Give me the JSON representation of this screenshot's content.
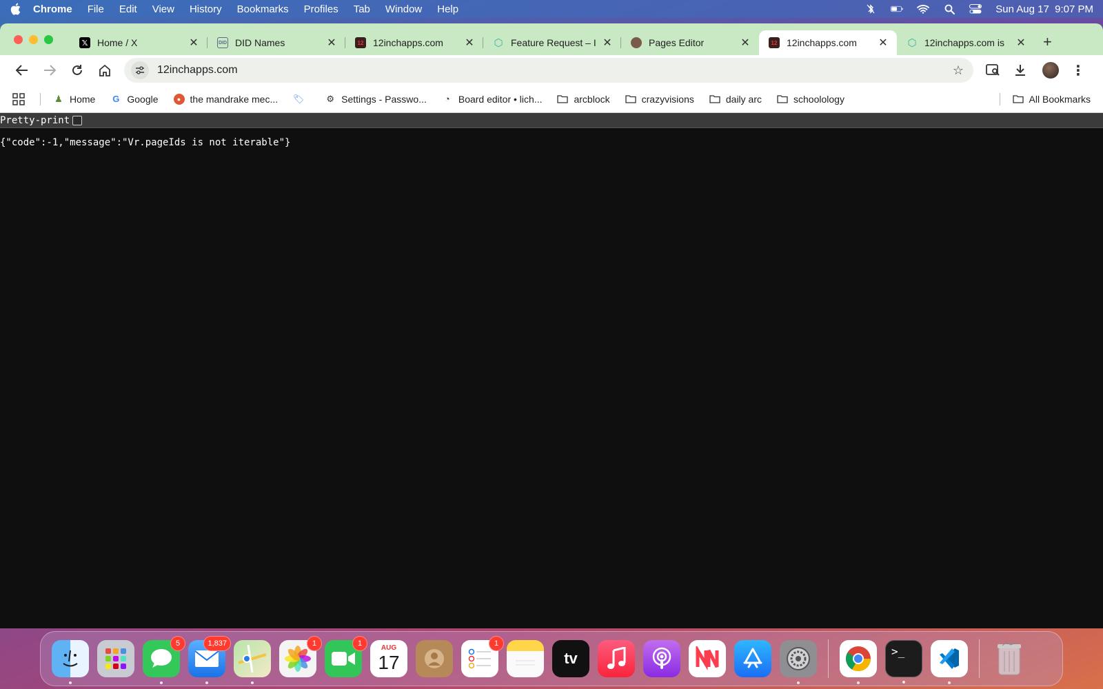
{
  "menubar": {
    "app": "Chrome",
    "items": [
      "File",
      "Edit",
      "View",
      "History",
      "Bookmarks",
      "Profiles",
      "Tab",
      "Window",
      "Help"
    ],
    "clock": "Sun Aug 17  9:07 PM"
  },
  "tabs": [
    {
      "title": "Home / X",
      "favicon": "x-icon"
    },
    {
      "title": "DID Names",
      "favicon": "did-icon"
    },
    {
      "title": "12inchapps.com",
      "favicon": "12inch-icon"
    },
    {
      "title": "Feature Request – I",
      "favicon": "hex-icon"
    },
    {
      "title": "Pages Editor",
      "favicon": "pages-icon"
    },
    {
      "title": "12inchapps.com",
      "favicon": "12inch-icon",
      "active": true
    },
    {
      "title": "12inchapps.com is",
      "favicon": "hex-icon"
    }
  ],
  "toolbar": {
    "url": "12inchapps.com"
  },
  "bookmarks": {
    "items": [
      {
        "label": "Home",
        "icon": "chess-pawn-icon"
      },
      {
        "label": "Google",
        "icon": "google-icon"
      },
      {
        "label": "the mandrake mec...",
        "icon": "duckduckgo-icon"
      },
      {
        "label": "",
        "icon": "tag-icon"
      },
      {
        "label": "Settings - Passwo...",
        "icon": "gear-icon"
      },
      {
        "label": "Board editor • lich...",
        "icon": "lichess-icon"
      },
      {
        "label": "arcblock",
        "icon": "folder-icon"
      },
      {
        "label": "crazyvisions",
        "icon": "folder-icon"
      },
      {
        "label": "daily arc",
        "icon": "folder-icon"
      },
      {
        "label": "schoolology",
        "icon": "folder-icon"
      }
    ],
    "all_bookmarks": "All Bookmarks"
  },
  "page": {
    "pretty_print_label": "Pretty-print",
    "json_text": "{\"code\":-1,\"message\":\"Vr.pageIds is not iterable\"}"
  },
  "dock": {
    "apps": [
      {
        "name": "Finder",
        "badge": "",
        "bg": "#3d8fe8"
      },
      {
        "name": "Launchpad",
        "badge": "",
        "bg": "#c9cbd3"
      },
      {
        "name": "Messages",
        "badge": "5",
        "bg": "#34c759"
      },
      {
        "name": "Mail",
        "badge": "1,837",
        "bg": "#2f8cf5"
      },
      {
        "name": "Maps",
        "badge": "",
        "bg": "#7ccf7a"
      },
      {
        "name": "Photos",
        "badge": "1",
        "bg": "#f4f4f4"
      },
      {
        "name": "FaceTime",
        "badge": "1",
        "bg": "#32c558"
      },
      {
        "name": "Calendar",
        "badge": "",
        "bg": "#ffffff",
        "month": "AUG",
        "day": "17"
      },
      {
        "name": "Contacts",
        "badge": "",
        "bg": "#b68a58"
      },
      {
        "name": "Reminders",
        "badge": "1",
        "bg": "#ffffff"
      },
      {
        "name": "Notes",
        "badge": "",
        "bg": "#ffe27a"
      },
      {
        "name": "TV",
        "badge": "",
        "bg": "#111111",
        "label": "tv"
      },
      {
        "name": "Music",
        "badge": "",
        "bg": "#fb3c53"
      },
      {
        "name": "Podcasts",
        "badge": "",
        "bg": "#9b4fde"
      },
      {
        "name": "News",
        "badge": "",
        "bg": "#ffffff"
      },
      {
        "name": "App Store",
        "badge": "",
        "bg": "#2a86f7"
      },
      {
        "name": "System Settings",
        "badge": "",
        "bg": "#8e8e93"
      },
      {
        "name": "Chrome",
        "badge": "",
        "bg": "#ffffff"
      },
      {
        "name": "Terminal",
        "badge": "",
        "bg": "#1c1c1c"
      },
      {
        "name": "VS Code",
        "badge": "",
        "bg": "#ffffff"
      },
      {
        "name": "Trash",
        "badge": "",
        "bg": "transparent"
      }
    ]
  }
}
